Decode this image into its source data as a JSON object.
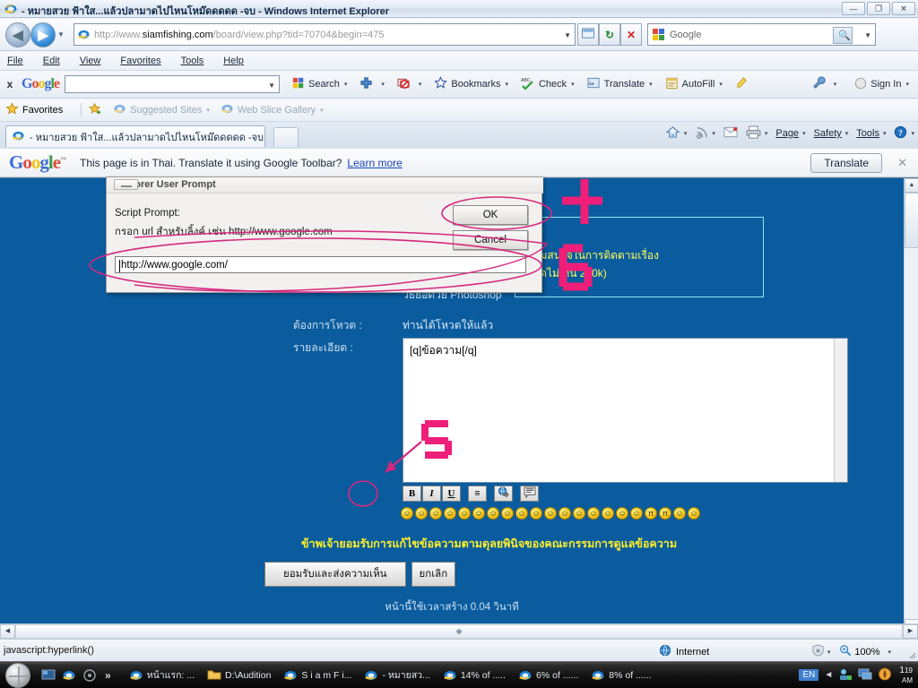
{
  "window": {
    "title": "- หมายสวย ฟ้าใส...แล้วปลามาดไปไหนโหม๊ดดดดด -จบ - Windows Internet Explorer",
    "icon": "ie-icon",
    "minimize_label": "—",
    "maximize_label": "❐",
    "close_label": "✕"
  },
  "address_bar": {
    "url_prefix": "http://www.",
    "url_domain": "siamfishing.com",
    "url_suffix": "/board/view.php?tid=70704&begin=475",
    "back_label": "◀",
    "forward_label": "▶",
    "dropdown_label": "▼",
    "refresh_label": "↻",
    "stop_label": "✕",
    "compat_label": "▤"
  },
  "search_box": {
    "value": "Google",
    "go_label": "🔍",
    "dropdown_label": "▼"
  },
  "menu_bar": {
    "items": [
      "File",
      "Edit",
      "View",
      "Favorites",
      "Tools",
      "Help"
    ]
  },
  "google_toolbar": {
    "close_label": "x",
    "logo": "Google",
    "input_value": "",
    "items": [
      {
        "label": "Search",
        "icon": "google-g-icon",
        "arrow": "▾"
      },
      {
        "label": "",
        "icon": "plus-icon",
        "arrow": "▾"
      },
      {
        "label": "",
        "icon": "popup-blocker-icon",
        "arrow": "▾"
      },
      {
        "label": "Bookmarks",
        "icon": "star-icon",
        "arrow": "▾"
      },
      {
        "label": "Check",
        "icon": "spellcheck-icon",
        "arrow": "▾"
      },
      {
        "label": "Translate",
        "icon": "translate-icon",
        "arrow": "▾"
      },
      {
        "label": "AutoFill",
        "icon": "autofill-icon",
        "arrow": "▾"
      },
      {
        "label": "",
        "icon": "highlighter-icon",
        "arrow": ""
      }
    ],
    "settings_label": "",
    "settings_arrow": "▾",
    "signin_label": "Sign In",
    "signin_arrow": "▾"
  },
  "favorites_bar": {
    "favorites_label": "Favorites",
    "items": [
      {
        "label": "Suggested Sites",
        "icon": "ie-icon",
        "arrow": "▾"
      },
      {
        "label": "Web Slice Gallery",
        "icon": "webslice-icon",
        "arrow": "▾"
      }
    ],
    "add_icon": "add-favorite-icon"
  },
  "tab_bar": {
    "tab_title": "- หมายสวย ฟ้าใส...แล้วปลามาดไปไหนโหม๊ดดดดด -จบ",
    "new_tab_label": "",
    "commands": [
      {
        "label": "",
        "icon": "home-icon",
        "arrow": "▾"
      },
      {
        "label": "",
        "icon": "feeds-icon",
        "arrow": "▾"
      },
      {
        "label": "",
        "icon": "mail-icon",
        "arrow": ""
      },
      {
        "label": "",
        "icon": "print-icon",
        "arrow": "▾"
      },
      {
        "label": "Page",
        "icon": "",
        "arrow": "▾"
      },
      {
        "label": "Safety",
        "icon": "",
        "arrow": "▾"
      },
      {
        "label": "Tools",
        "icon": "",
        "arrow": "▾"
      },
      {
        "label": "",
        "icon": "help-icon",
        "arrow": "▾"
      }
    ]
  },
  "translate_bar": {
    "logo": "Google",
    "trademark": "™",
    "message": "This page is in Thai.  Translate it using Google Toolbar?",
    "learn_more": "Learn more",
    "translate_button": "Translate",
    "close_label": "✕"
  },
  "dialog": {
    "title": "Explorer User Prompt",
    "minimize_label": "",
    "script_prompt_label": "Script Prompt:",
    "prompt_text": "กรอก url สำหรับลิ้งค์ เช่น http://www.google.com",
    "input_value": "http://www.google.com/",
    "ok_label": "OK",
    "cancel_label": "Cancel"
  },
  "page": {
    "upload_note_line1": "ความสนใจในการติดตามเรื่อง",
    "upload_note_line2": "ขนาดไม่เกิน 200k)",
    "photoshop_link": "วิธีย่อด้วย Photoshop",
    "vote_label": "ต้องการโหวต :",
    "vote_value": "ท่านได้โหวตให้แล้ว",
    "detail_label": "รายละเอียด :",
    "textarea_value": "[q]ข้อความ[/q]",
    "format_buttons": [
      {
        "name": "bold-button",
        "glyph": "B"
      },
      {
        "name": "italic-button",
        "glyph": "I"
      },
      {
        "name": "underline-button",
        "glyph": "U"
      },
      {
        "name": "align-button",
        "glyph": "≡"
      },
      {
        "name": "link-button",
        "glyph": "🌐"
      },
      {
        "name": "quote-button",
        "glyph": "▤"
      }
    ],
    "emoticons": [
      "ʘ",
      "□",
      "○",
      "◑",
      "•",
      "•",
      "•",
      "•",
      "○",
      "•",
      "•",
      "◔",
      "•",
      "◕",
      "✕",
      "•",
      "π",
      "π",
      "•",
      "•",
      "•"
    ],
    "agree_text": "ข้าพเจ้ายอมรับการแก้ไขข้อความตามดุลยพินิจของคณะกรรมการดูแลข้อความ",
    "submit_label": "ยอมรับและส่งความเห็น",
    "cancel_label": "ยกเลิก",
    "footer_time": "หน้านี้ใช้เวลาสร้าง 0.04 วินาที"
  },
  "status_bar": {
    "status_text": "javascript:hyperlink()",
    "zone_label": "Internet",
    "zone_icon": "globe-icon",
    "protected_icon": "protected-mode-icon",
    "protected_arrow": "▾",
    "zoom_icon": "zoom-icon",
    "zoom_level": "100%",
    "zoom_arrow": "▾"
  },
  "taskbar": {
    "start_label": "",
    "quick_launch": [
      {
        "name": "show-desktop-icon"
      },
      {
        "name": "ie-icon"
      },
      {
        "name": "media-icon"
      }
    ],
    "more_label": "»",
    "tasks": [
      {
        "label": "หน้าแรก: ...",
        "icon": "ie-icon"
      },
      {
        "label": "D:\\Audition",
        "icon": "folder-icon"
      },
      {
        "label": "S i a m F i...",
        "icon": "ie-icon"
      },
      {
        "label": "- หมายสว...",
        "icon": "ie-icon"
      },
      {
        "label": "14% of .....",
        "icon": "ie-icon"
      },
      {
        "label": "6% of ......",
        "icon": "ie-icon"
      },
      {
        "label": "8% of ......",
        "icon": "ie-icon"
      }
    ],
    "language": "EN",
    "tray_arrow": "◄",
    "tray_icons": [
      "network-icon",
      "display-icon",
      "shield-icon"
    ],
    "clock_hour": "1",
    "clock_minute": "19",
    "clock_period": "AM"
  },
  "colors": {
    "page_blue": "#0a5c9e",
    "annotation_pink": "#ec2d8a",
    "yellow_text": "#fffa5a",
    "agree_yellow": "#ffef2b",
    "link_blue": "#1a44b8"
  }
}
